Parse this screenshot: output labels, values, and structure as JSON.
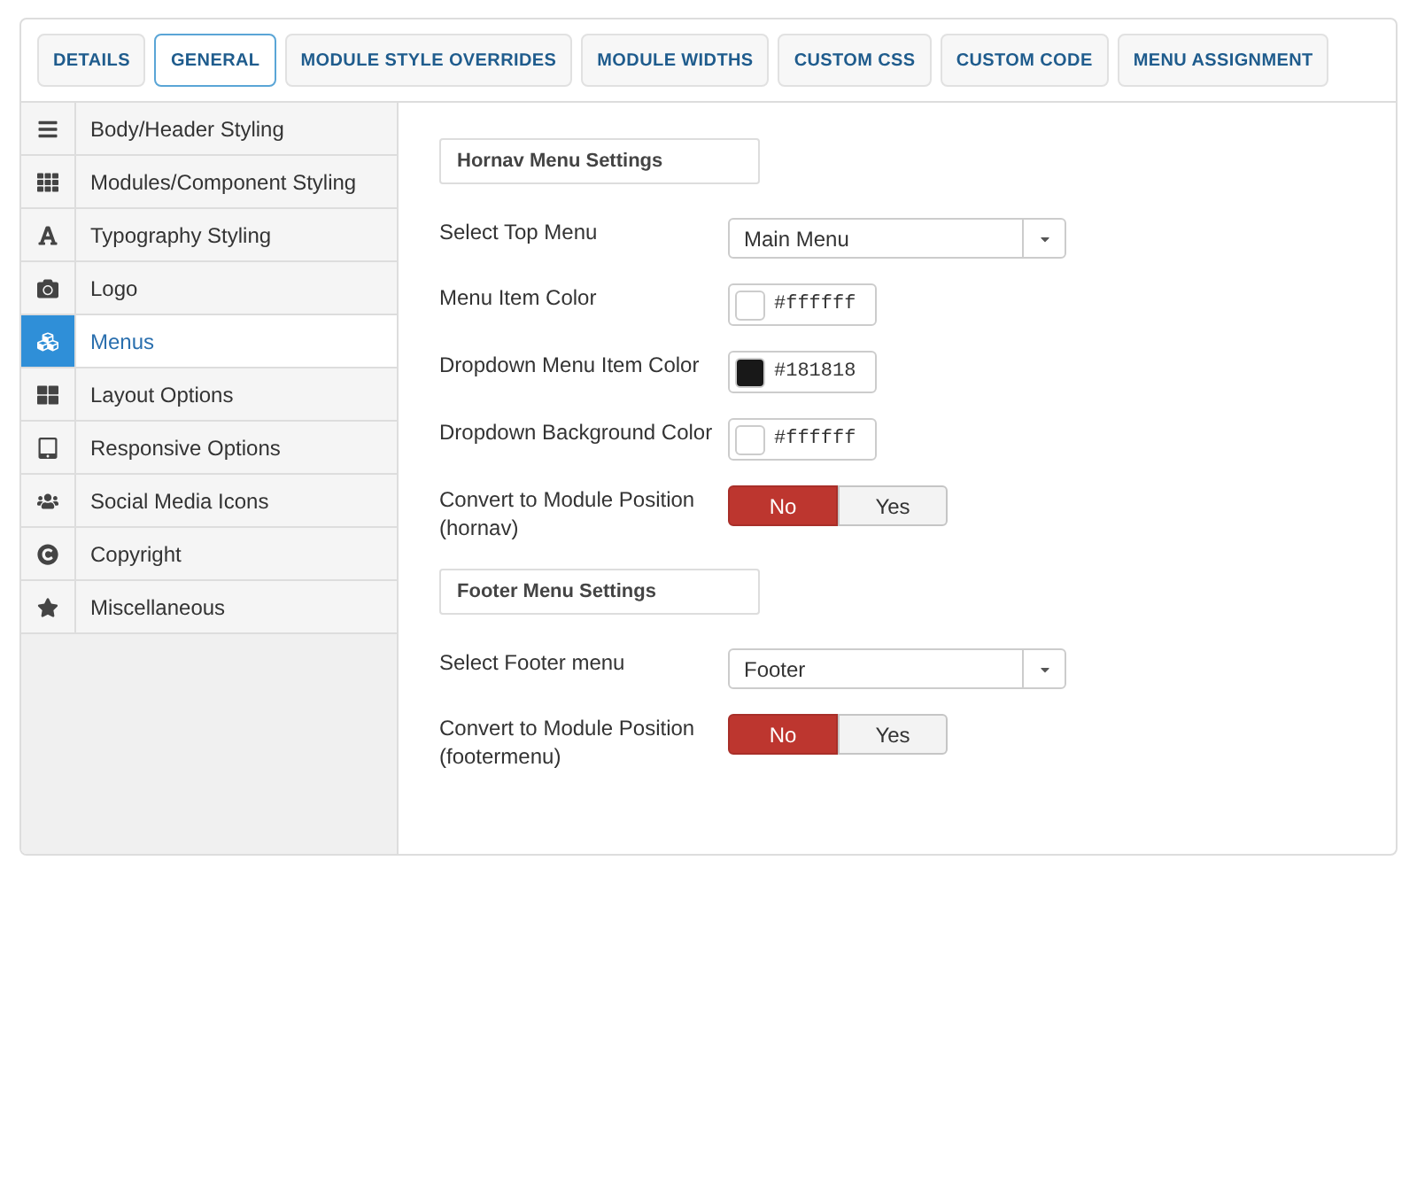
{
  "tabs": [
    {
      "label": "DETAILS",
      "selected": false
    },
    {
      "label": "GENERAL",
      "selected": true
    },
    {
      "label": "MODULE STYLE OVERRIDES",
      "selected": false
    },
    {
      "label": "MODULE WIDTHS",
      "selected": false
    },
    {
      "label": "CUSTOM CSS",
      "selected": false
    },
    {
      "label": "CUSTOM CODE",
      "selected": false
    },
    {
      "label": "MENU ASSIGNMENT",
      "selected": false
    }
  ],
  "sidebar": {
    "items": [
      {
        "label": "Body/Header Styling",
        "selected": false
      },
      {
        "label": "Modules/Component Styling",
        "selected": false
      },
      {
        "label": "Typography Styling",
        "selected": false
      },
      {
        "label": "Logo",
        "selected": false
      },
      {
        "label": "Menus",
        "selected": true
      },
      {
        "label": "Layout Options",
        "selected": false
      },
      {
        "label": "Responsive Options",
        "selected": false
      },
      {
        "label": "Social Media Icons",
        "selected": false
      },
      {
        "label": "Copyright",
        "selected": false
      },
      {
        "label": "Miscellaneous",
        "selected": false
      }
    ]
  },
  "sections": [
    {
      "title": "Hornav Menu Settings",
      "fields": [
        {
          "kind": "select",
          "label": "Select Top Menu",
          "value": "Main Menu"
        },
        {
          "kind": "color",
          "label": "Menu Item Color",
          "value": "#ffffff"
        },
        {
          "kind": "color",
          "label": "Dropdown Menu Item Color",
          "value": "#181818"
        },
        {
          "kind": "color",
          "label": "Dropdown Background Color",
          "value": "#ffffff"
        },
        {
          "kind": "toggle",
          "label": "Convert to Module Position",
          "sublabel": "(hornav)",
          "options": [
            {
              "label": "No",
              "selected": true
            },
            {
              "label": "Yes",
              "selected": false
            }
          ]
        }
      ]
    },
    {
      "title": "Footer Menu Settings",
      "fields": [
        {
          "kind": "select",
          "label": "Select Footer menu",
          "value": "Footer"
        },
        {
          "kind": "toggle",
          "label": "Convert to Module Position",
          "sublabel": "(footermenu)",
          "options": [
            {
              "label": "No",
              "selected": true
            },
            {
              "label": "Yes",
              "selected": false
            }
          ]
        }
      ]
    }
  ]
}
